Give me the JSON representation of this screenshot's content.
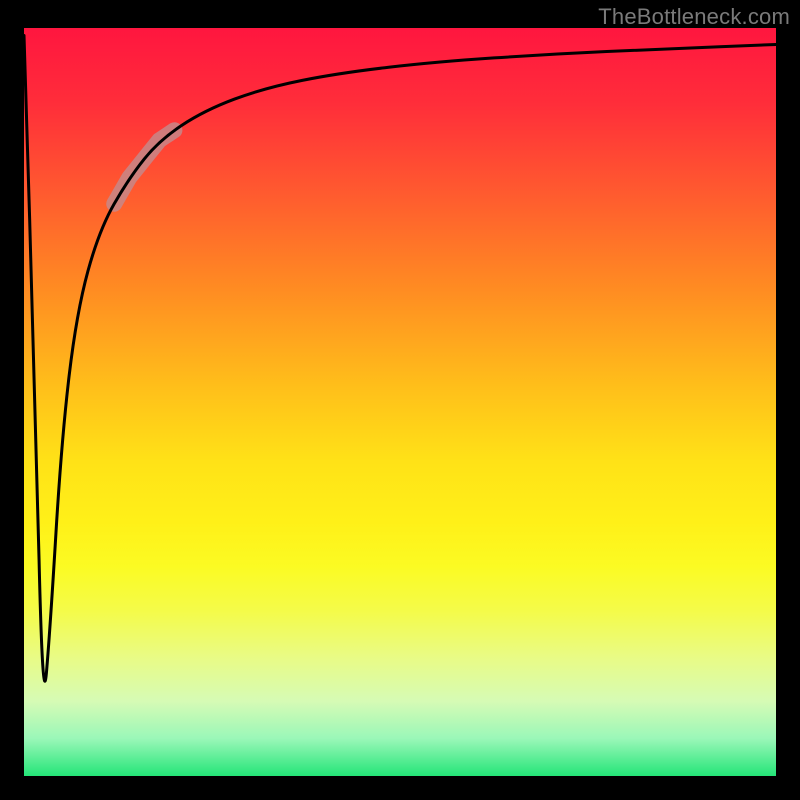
{
  "watermark": "TheBottleneck.com",
  "chart_data": {
    "type": "line",
    "title": "",
    "xlabel": "",
    "ylabel": "",
    "xlim": [
      0,
      100
    ],
    "ylim": [
      0,
      100
    ],
    "grid": false,
    "series": [
      {
        "name": "curve",
        "x": [
          0,
          1.5,
          2.5,
          3.5,
          5,
          7,
          10,
          14,
          18,
          24,
          32,
          42,
          55,
          70,
          85,
          100
        ],
        "y": [
          99,
          50,
          8,
          20,
          45,
          62,
          73,
          80,
          85,
          89,
          92,
          94,
          95.5,
          96.5,
          97.2,
          97.8
        ]
      }
    ],
    "highlight_range_x": [
      12,
      20
    ],
    "colors": {
      "curve": "#000000",
      "highlight": "#c58a8c",
      "gradient_top": "#ff163f",
      "gradient_mid": "#fff018",
      "gradient_bottom": "#24e578",
      "frame": "#000000"
    }
  }
}
